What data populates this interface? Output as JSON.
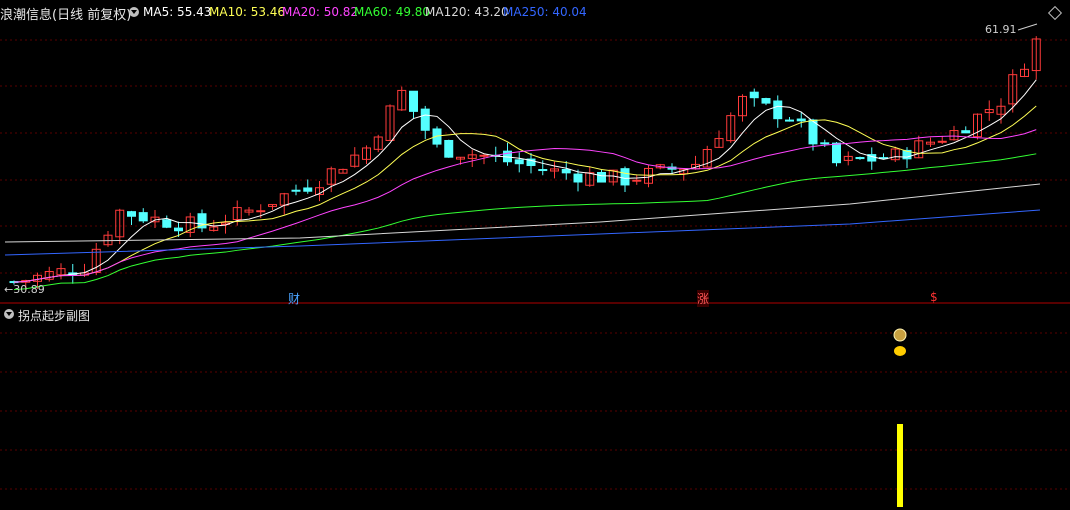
{
  "header": {
    "title": "浪潮信息(日线 前复权)",
    "ma": [
      {
        "label": "MA5: 55.43",
        "color": "#ffffff"
      },
      {
        "label": "MA10: 53.46",
        "color": "#ffff55"
      },
      {
        "label": "MA20: 50.82",
        "color": "#ff44ff"
      },
      {
        "label": "MA60: 49.80",
        "color": "#33ff33"
      },
      {
        "label": "MA120: 43.20",
        "color": "#d8d8d8"
      },
      {
        "label": "MA250: 40.04",
        "color": "#3366ff"
      }
    ]
  },
  "price_labels": {
    "high": "61.91",
    "low": "30.89"
  },
  "markers": [
    {
      "text": "财",
      "color": "#4aa3ff"
    },
    {
      "text": "涨",
      "color": "#ff5555"
    },
    {
      "text": "$",
      "color": "#ff3333"
    }
  ],
  "subchart": {
    "title": "拐点起步副图"
  },
  "colors": {
    "up": "#ff3b3b",
    "down": "#54ffff",
    "grid": "#5a0000",
    "separator": "#b00000"
  },
  "icons": [
    "collapse-icon",
    "money-bag-icon",
    "gold-coin-icon",
    "arrow-icon",
    "diamond-icon"
  ]
}
